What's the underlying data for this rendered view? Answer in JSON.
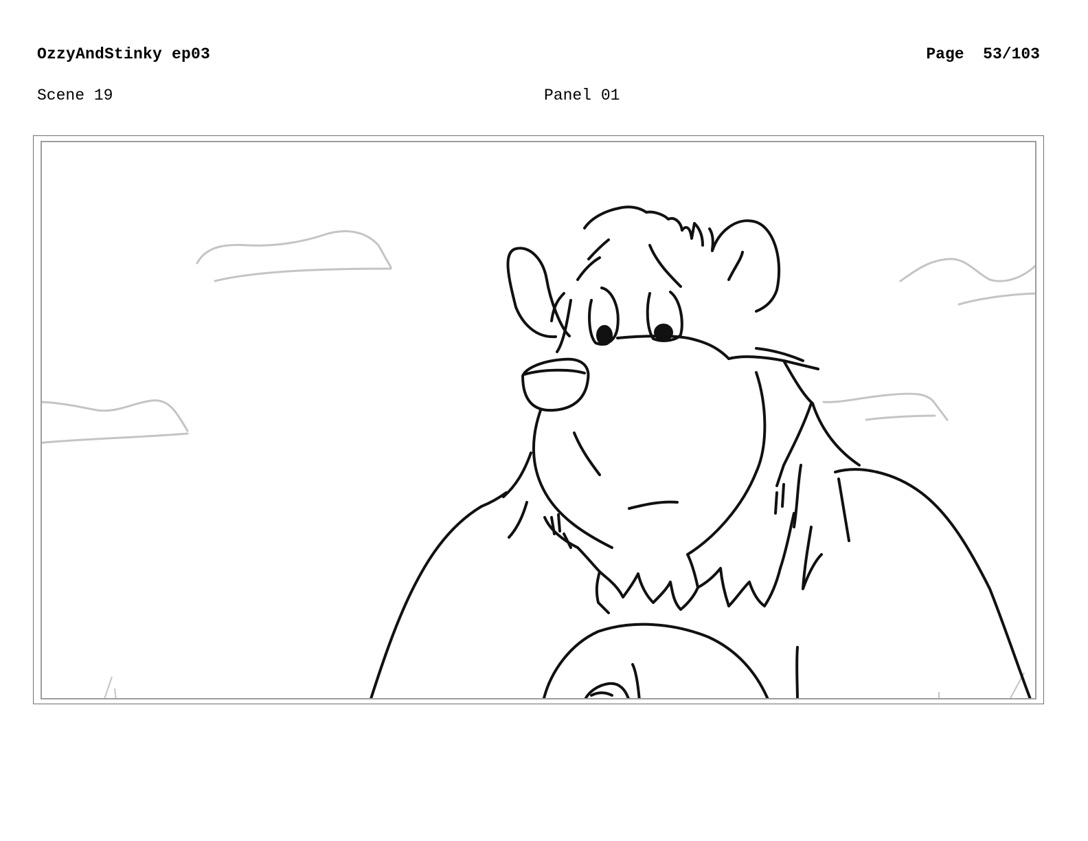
{
  "header": {
    "title": "OzzyAndStinky ep03",
    "page": "Page  53/103"
  },
  "scene": {
    "label": "Scene 19"
  },
  "panel": {
    "label": "Panel 01",
    "subject_icon": "bear-character-sketch-icon",
    "background_icon": "cloud-sketch-icon"
  },
  "colors": {
    "sketch_line": "#111111",
    "cloud_line": "#c4c4c4",
    "frame_outer": "#6e6e6e",
    "frame_inner": "#9c9c9c"
  }
}
